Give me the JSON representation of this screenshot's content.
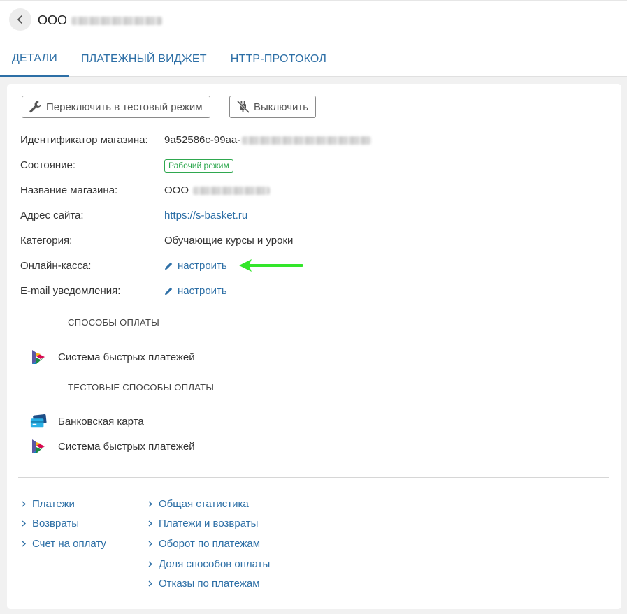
{
  "header": {
    "title_prefix": "ООО",
    "back_icon": "chevron-left-icon"
  },
  "tabs": [
    {
      "label": "ДЕТАЛИ",
      "active": true
    },
    {
      "label": "ПЛАТЕЖНЫЙ ВИДЖЕТ",
      "active": false
    },
    {
      "label": "HTTP-ПРОТОКОЛ",
      "active": false
    }
  ],
  "toolbar": {
    "test_mode_label": "Переключить в тестовый режим",
    "test_mode_icon": "wrench-icon",
    "disable_label": "Выключить",
    "disable_icon": "unplug-icon"
  },
  "details": {
    "shop_id_label": "Идентификатор магазина:",
    "shop_id_value": "9a52586c-99aa-",
    "status_label": "Состояние:",
    "status_value": "Рабочий режим",
    "shop_name_label": "Название магазина:",
    "shop_name_value": "ООО",
    "site_label": "Адрес сайта:",
    "site_value": "https://s-basket.ru",
    "category_label": "Категория:",
    "category_value": "Обучающие курсы и уроки",
    "online_cash_label": "Онлайн-касса:",
    "online_cash_action": "настроить",
    "email_label": "E-mail уведомления:",
    "email_action": "настроить"
  },
  "payment_methods": {
    "title": "СПОСОБЫ ОПЛАТЫ",
    "items": [
      {
        "label": "Система быстрых платежей",
        "icon": "sbp-logo-icon"
      }
    ]
  },
  "test_payment_methods": {
    "title": "ТЕСТОВЫЕ СПОСОБЫ ОПЛАТЫ",
    "items": [
      {
        "label": "Банковская карта",
        "icon": "bank-card-icon"
      },
      {
        "label": "Система быстрых платежей",
        "icon": "sbp-logo-icon"
      }
    ]
  },
  "links_left": [
    "Платежи",
    "Возвраты",
    "Счет на оплату"
  ],
  "links_right": [
    "Общая статистика",
    "Платежи и возвраты",
    "Оборот по платежам",
    "Доля способов оплаты",
    "Отказы по платежам"
  ],
  "colors": {
    "accent": "#2d6fa6",
    "status_green": "#2fa84f",
    "annotation_arrow": "#33e62a"
  }
}
